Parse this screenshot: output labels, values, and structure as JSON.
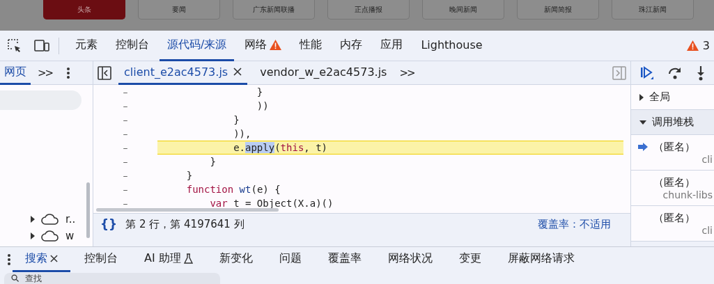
{
  "page_tabs": [
    {
      "label": "头条",
      "selected": true
    },
    {
      "label": "要闻",
      "selected": false
    },
    {
      "label": "广东新闻联播",
      "selected": false
    },
    {
      "label": "正点播报",
      "selected": false
    },
    {
      "label": "晚间新闻",
      "selected": false
    },
    {
      "label": "新闻简报",
      "selected": false
    },
    {
      "label": "珠江新闻",
      "selected": false
    }
  ],
  "devtools_tabs": [
    {
      "label": "元素",
      "selected": false,
      "warning": false
    },
    {
      "label": "控制台",
      "selected": false,
      "warning": false
    },
    {
      "label": "源代码/来源",
      "selected": true,
      "warning": false
    },
    {
      "label": "网络",
      "selected": false,
      "warning": true
    },
    {
      "label": "性能",
      "selected": false,
      "warning": false
    },
    {
      "label": "内存",
      "selected": false,
      "warning": false
    },
    {
      "label": "应用",
      "selected": false,
      "warning": false
    },
    {
      "label": "Lighthouse",
      "selected": false,
      "warning": false
    }
  ],
  "issues_count": "3",
  "navigator": {
    "tab": "网页",
    "more": ">>",
    "items": [
      {
        "label": "r.."
      },
      {
        "label": "w"
      }
    ]
  },
  "file_tabs": [
    {
      "label": "client_e2ac4573.js",
      "selected": true,
      "closable": true
    },
    {
      "label": "vendor_w_e2ac4573.js",
      "selected": false,
      "closable": false
    }
  ],
  "file_tabs_more": ">>",
  "code_lines": [
    {
      "gutter": "–",
      "current": false,
      "tokens": [
        {
          "text": "                }",
          "kind": "plain"
        }
      ]
    },
    {
      "gutter": "–",
      "current": false,
      "tokens": [
        {
          "text": "                ))",
          "kind": "plain"
        }
      ]
    },
    {
      "gutter": "–",
      "current": false,
      "tokens": [
        {
          "text": "            }",
          "kind": "plain"
        }
      ]
    },
    {
      "gutter": "–",
      "current": false,
      "tokens": [
        {
          "text": "            )),",
          "kind": "plain"
        }
      ]
    },
    {
      "gutter": "–",
      "current": true,
      "tokens": [
        {
          "text": "            e.",
          "kind": "plain"
        },
        {
          "text": "apply",
          "kind": "selection"
        },
        {
          "text": "(",
          "kind": "plain"
        },
        {
          "text": "this",
          "kind": "keyword"
        },
        {
          "text": ", t)",
          "kind": "plain"
        }
      ]
    },
    {
      "gutter": "–",
      "current": false,
      "tokens": [
        {
          "text": "        }",
          "kind": "plain"
        }
      ]
    },
    {
      "gutter": "–",
      "current": false,
      "tokens": [
        {
          "text": "    }",
          "kind": "plain"
        }
      ]
    },
    {
      "gutter": "–",
      "current": false,
      "tokens": [
        {
          "text": "    function",
          "kind": "keyword"
        },
        {
          "text": " wt",
          "kind": "name"
        },
        {
          "text": "(e) {",
          "kind": "plain"
        }
      ]
    },
    {
      "gutter": "–",
      "current": false,
      "tokens": [
        {
          "text": "        var",
          "kind": "keyword"
        },
        {
          "text": " t = Object(X.a)()",
          "kind": "plain"
        }
      ]
    }
  ],
  "status": {
    "braces": "{}",
    "position": "第 2 行，第 4197641 列",
    "coverage": "覆盖率：不适用"
  },
  "scope_sections": [
    {
      "label": "全局",
      "expanded": false
    },
    {
      "label": "调用堆栈",
      "expanded": true
    }
  ],
  "call_frames": [
    {
      "name": "（匿名）",
      "file": "cli",
      "current": true
    },
    {
      "name": "（匿名）",
      "file": "chunk-libs",
      "current": false
    },
    {
      "name": "（匿名）",
      "file": "cli",
      "current": false
    }
  ],
  "drawer_tabs": [
    {
      "label": "搜索",
      "selected": true,
      "closable": true,
      "experimental": false
    },
    {
      "label": "控制台",
      "selected": false,
      "closable": false,
      "experimental": false
    },
    {
      "label": "AI 助理",
      "selected": false,
      "closable": false,
      "experimental": true
    },
    {
      "label": "新变化",
      "selected": false,
      "closable": false,
      "experimental": false
    },
    {
      "label": "问题",
      "selected": false,
      "closable": false,
      "experimental": false
    },
    {
      "label": "覆盖率",
      "selected": false,
      "closable": false,
      "experimental": false
    },
    {
      "label": "网络状况",
      "selected": false,
      "closable": false,
      "experimental": false
    },
    {
      "label": "变更",
      "selected": false,
      "closable": false,
      "experimental": false
    },
    {
      "label": "屏蔽网络请求",
      "selected": false,
      "closable": false,
      "experimental": false
    }
  ],
  "search": {
    "placeholder": "查找"
  }
}
